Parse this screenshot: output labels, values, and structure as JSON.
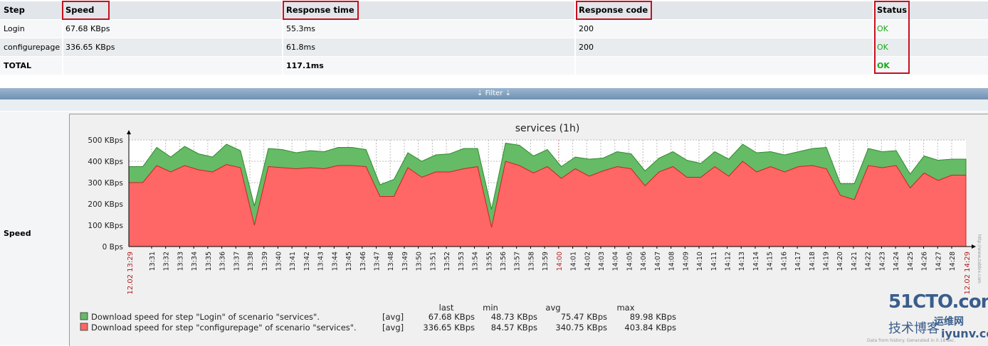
{
  "table": {
    "headers": [
      "Step",
      "Speed",
      "Response time",
      "Response code",
      "Status"
    ],
    "rows": [
      {
        "step": "Login",
        "speed": "67.68 KBps",
        "response_time": "55.3ms",
        "response_code": "200",
        "status": "OK"
      },
      {
        "step": "configurepage",
        "speed": "336.65 KBps",
        "response_time": "61.8ms",
        "response_code": "200",
        "status": "OK"
      },
      {
        "step": "TOTAL",
        "speed": "",
        "response_time": "117.1ms",
        "response_code": "",
        "status": "OK"
      }
    ]
  },
  "filter": {
    "label": "Filter",
    "icon": "double-chevron-down-icon"
  },
  "speed_section": {
    "label": "Speed"
  },
  "chart_data": {
    "type": "area",
    "title": "services (1h)",
    "y_tick_labels": [
      "500 KBps",
      "400 KBps",
      "300 KBps",
      "200 KBps",
      "100 KBps",
      "0 Bps"
    ],
    "ylim": [
      0,
      500
    ],
    "x_start_label": "12.02 13:29",
    "x_end_label": "12.02 14:29",
    "x_tick_labels": [
      "13:31",
      "13:32",
      "13:33",
      "13:34",
      "13:35",
      "13:36",
      "13:37",
      "13:38",
      "13:39",
      "13:40",
      "13:41",
      "13:42",
      "13:43",
      "13:44",
      "13:45",
      "13:46",
      "13:47",
      "13:48",
      "13:49",
      "13:50",
      "13:51",
      "13:52",
      "13:53",
      "13:54",
      "13:55",
      "13:56",
      "13:57",
      "13:58",
      "13:59",
      "14:00",
      "14:01",
      "14:02",
      "14:03",
      "14:04",
      "14:05",
      "14:06",
      "14:07",
      "14:08",
      "14:09",
      "14:10",
      "14:11",
      "14:12",
      "14:13",
      "14:14",
      "14:15",
      "14:16",
      "14:17",
      "14:18",
      "14:19",
      "14:20",
      "14:21",
      "14:22",
      "14:23",
      "14:24",
      "14:25",
      "14:26",
      "14:27",
      "14:28"
    ],
    "highlight_tick": "14:00",
    "grid": true,
    "stacked": true,
    "series": [
      {
        "name": "Download speed for step \"configurepage\" of scenario \"services\".",
        "color": "#ff6666",
        "edge_color": "#cc2222",
        "values": [
          300,
          300,
          380,
          350,
          380,
          360,
          350,
          385,
          370,
          100,
          375,
          370,
          365,
          370,
          365,
          380,
          380,
          375,
          235,
          235,
          370,
          325,
          350,
          350,
          365,
          375,
          90,
          400,
          380,
          345,
          375,
          320,
          365,
          330,
          355,
          375,
          365,
          285,
          350,
          375,
          325,
          325,
          375,
          330,
          400,
          350,
          375,
          350,
          375,
          380,
          365,
          240,
          220,
          380,
          370,
          380,
          275,
          345,
          310,
          335,
          335
        ]
      },
      {
        "name": "Download speed for step \"Login\" of scenario \"services\".",
        "color": "#66bb66",
        "edge_color": "#2e8b2e",
        "values": [
          75,
          75,
          85,
          70,
          90,
          75,
          70,
          95,
          80,
          90,
          85,
          85,
          75,
          80,
          80,
          85,
          85,
          80,
          55,
          80,
          70,
          75,
          80,
          85,
          95,
          85,
          85,
          85,
          95,
          80,
          80,
          55,
          55,
          80,
          60,
          70,
          70,
          70,
          65,
          70,
          80,
          65,
          70,
          80,
          80,
          90,
          70,
          80,
          70,
          80,
          100,
          55,
          75,
          80,
          75,
          70,
          65,
          80,
          95,
          75,
          75
        ]
      }
    ],
    "legend": {
      "columns": [
        "last",
        "min",
        "avg",
        "max"
      ],
      "entries": [
        {
          "text": "Download speed for step \"Login\" of scenario \"services\".",
          "func": "[avg]",
          "last": "67.68 KBps",
          "min": "48.73 KBps",
          "avg": "75.47 KBps",
          "max": "89.98 KBps",
          "color": "#66bb66"
        },
        {
          "text": "Download speed for step \"configurepage\" of scenario \"services\".",
          "func": "[avg]",
          "last": "336.65 KBps",
          "min": "84.57 KBps",
          "avg": "340.75 KBps",
          "max": "403.84 KBps",
          "color": "#ff6666"
        }
      ]
    },
    "footnote": "Data from history. Generated in 0.18 sec.",
    "side_note": "http://www.zabbix.com"
  },
  "watermark": {
    "line1": "51CTO.com",
    "line2": "技术博客",
    "line3": "iyunv.com",
    "line4": "运维网"
  }
}
